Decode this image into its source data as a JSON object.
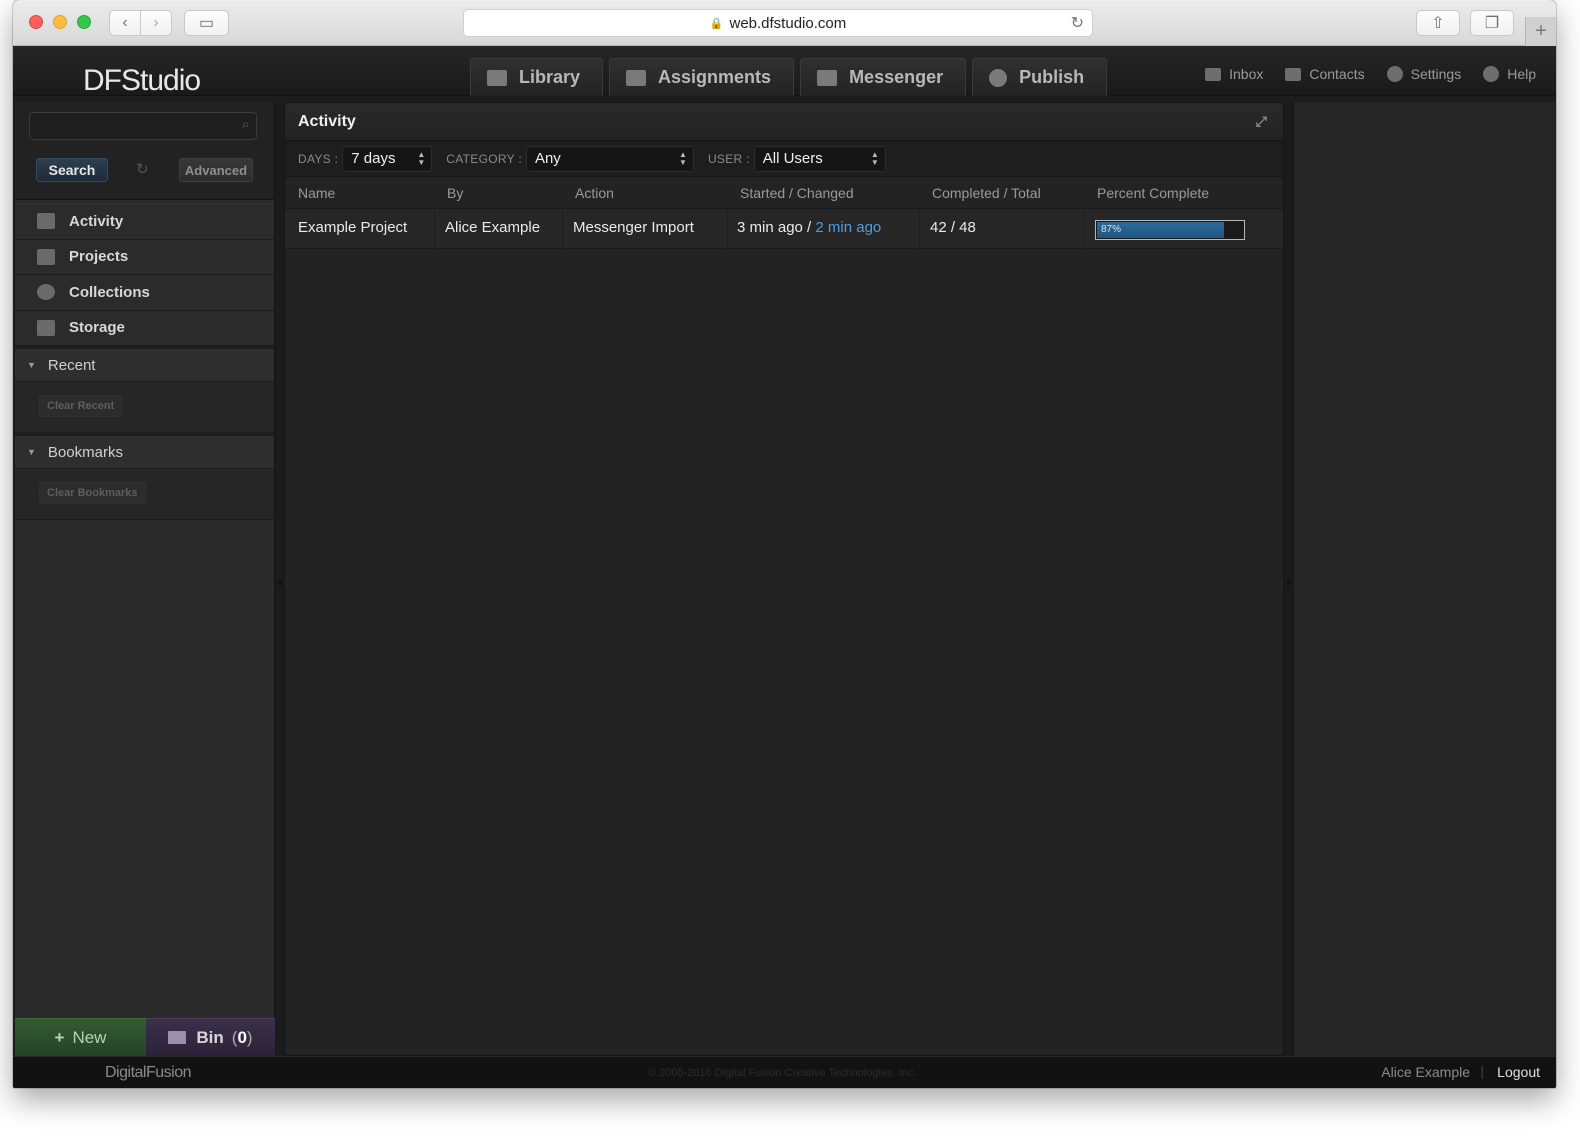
{
  "browser": {
    "url": "web.dfstudio.com"
  },
  "app": {
    "logo": "DFStudio",
    "main_tabs": [
      {
        "label": "Library",
        "icon": "library-icon"
      },
      {
        "label": "Assignments",
        "icon": "assignments-icon"
      },
      {
        "label": "Messenger",
        "icon": "messenger-icon"
      },
      {
        "label": "Publish",
        "icon": "publish-icon"
      }
    ],
    "top_links": [
      {
        "label": "Inbox",
        "icon": "inbox-icon"
      },
      {
        "label": "Contacts",
        "icon": "contacts-icon"
      },
      {
        "label": "Settings",
        "icon": "gear-icon"
      },
      {
        "label": "Help",
        "icon": "help-icon"
      }
    ]
  },
  "sidebar": {
    "search_button": "Search",
    "advanced_button": "Advanced",
    "nav": [
      {
        "label": "Activity",
        "icon": "bar-chart-icon"
      },
      {
        "label": "Projects",
        "icon": "layers-icon"
      },
      {
        "label": "Collections",
        "icon": "database-icon"
      },
      {
        "label": "Storage",
        "icon": "storage-icon"
      }
    ],
    "recent": {
      "title": "Recent",
      "clear_label": "Clear Recent"
    },
    "bookmarks": {
      "title": "Bookmarks",
      "clear_label": "Clear Bookmarks"
    },
    "new_button": "New",
    "bin_button": "Bin",
    "bin_count": "0"
  },
  "activity": {
    "title": "Activity",
    "filters": {
      "days_label": "DAYS :",
      "days_value": "7 days",
      "category_label": "CATEGORY :",
      "category_value": "Any",
      "user_label": "USER :",
      "user_value": "All Users"
    },
    "columns": [
      "Name",
      "By",
      "Action",
      "Started / Changed",
      "Completed / Total",
      "Percent Complete"
    ],
    "rows": [
      {
        "name": "Example Project",
        "by": "Alice Example",
        "action": "Messenger Import",
        "started": "3 min ago",
        "separator": " / ",
        "changed": "2 min ago",
        "completed_total": "42 / 48",
        "percent_label": "87%",
        "percent": 87
      }
    ]
  },
  "footer": {
    "logo": "DigitalFusion",
    "copyright": "© 2006-2016 Digital Fusion Creative Technologies, Inc.",
    "user": "Alice Example",
    "separator": "|",
    "logout": "Logout"
  },
  "colors": {
    "accent_blue": "#4a9ee0",
    "progress_fill": "#1f5680",
    "new_button": "#2e512e",
    "bin_button": "#33283f"
  }
}
